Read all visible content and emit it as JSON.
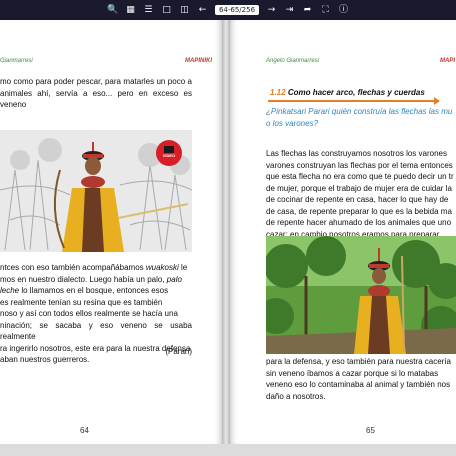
{
  "toolbar": {
    "page_indicator": "64-65/256",
    "icons": [
      "zoom-icon",
      "grid-icon",
      "list-icon",
      "single-page-icon",
      "double-page-icon",
      "back-icon",
      "forward-icon",
      "share-icon",
      "fullscreen-icon",
      "info-icon"
    ]
  },
  "left_page": {
    "running_author": "Gianmarresi",
    "running_title": "MAPINIKI",
    "paragraph1": "mo como para poder pescar, para matarles un poco a animales ahí, servía a eso... pero en exceso es veneno",
    "badge_text": "VIDEO",
    "paragraph2_l1": "ntces con eso también acompañábamos",
    "paragraph2_wuakoski": "wuakoski",
    "paragraph2_l1b": "le",
    "paragraph2_l2": "mos en nuestro dialecto. Luego había un palo,",
    "paragraph2_palo": "palo",
    "paragraph2_l3a": "leche",
    "paragraph2_l3b": "lo llamamos en el bosque, entonces esos",
    "paragraph2_l4": "es realmente tenían su resina que es también",
    "paragraph2_l5": "noso y así con todos ellos realmente se hacía una",
    "paragraph2_l6": "ninación; se sacaba y eso veneno se usaba realmente",
    "paragraph2_l7": "ra ingerirlo nosotros, este era para la nuestra defensa",
    "paragraph2_l8": "aban nuestros guerreros.",
    "attribution": "(Parari)",
    "page_number": "64"
  },
  "right_page": {
    "running_author": "Angelo Gianmarresi",
    "running_title": "MAPI",
    "section_number": "1.12",
    "section_title": "Como hacer arco, flechas y cuerdas",
    "question_l1": "¿Pinkatsari Parari quién construía las flechas las mu",
    "question_l2": "o los varones?",
    "lines": [
      "Las flechas las construyamos nosotros los varones",
      "varones construyan las flechas por el tema entonces",
      "que esta flecha no era como que te puedo decir un tr",
      "de mujer, porque el trabajo de mujer era de cuidar la",
      "de cocinar de repente en casa, hacer lo que hay de",
      "de casa, de repente preparar lo que es la bebida ma",
      "de repente hacer ahumado de los animales que uno",
      "cazar; en cambio nosotros eramos para preparar"
    ],
    "lines_after": [
      "para la defensa, y eso también para nuestra cacería",
      "sin veneno íbamos a cazar porque si lo matabas",
      "veneno eso lo contaminaba al animal y también nos",
      "daño a nosotros."
    ],
    "page_number": "65"
  },
  "colors": {
    "toolbar_bg": "#1a1a2e",
    "heading_orange": "#e67e22",
    "question_blue": "#2e86c1",
    "running_green": "#3f8a3a",
    "running_red": "#c0392b"
  }
}
